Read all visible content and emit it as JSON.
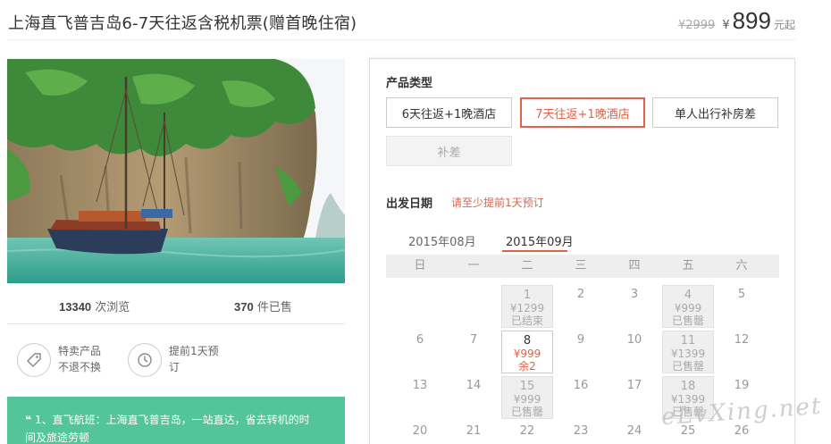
{
  "product": {
    "title": "上海直飞普吉岛6-7天往返含税机票(赠首晚住宿)",
    "original_price": "¥2999",
    "currency_symbol": "¥",
    "price": "899",
    "price_unit": "元起"
  },
  "stats": {
    "views_count": "13340",
    "views_label": "次浏览",
    "sold_count": "370",
    "sold_label": "件已售"
  },
  "features": [
    {
      "icon": "tag-icon",
      "text1": "特卖产品",
      "text2": "不退不换"
    },
    {
      "icon": "clock-icon",
      "text1": "提前1天预",
      "text2": "订"
    }
  ],
  "highlight": {
    "quote": "❝",
    "line1": "1、直飞航班：上海直飞普吉岛，一站直达，省去转机的时",
    "line2": "间及旅途劳顿"
  },
  "product_type": {
    "label": "产品类型",
    "options": [
      "6天往返+1晚酒店",
      "7天往返+1晚酒店",
      "单人出行补房差",
      "补差"
    ]
  },
  "departure": {
    "label": "出发日期",
    "notice": "请至少提前1天预订",
    "months": [
      "2015年08月",
      "2015年09月"
    ],
    "weekdays": [
      "日",
      "一",
      "二",
      "三",
      "四",
      "五",
      "六"
    ],
    "days": [
      {
        "day": "1",
        "price": "¥1299",
        "status": "已结束"
      },
      {
        "day": "2"
      },
      {
        "day": "3"
      },
      {
        "day": "4",
        "price": "¥999",
        "status": "已售罄"
      },
      {
        "day": "5"
      },
      {
        "day": "6"
      },
      {
        "day": "7"
      },
      {
        "day": "8",
        "price": "¥999",
        "status": "余2"
      },
      {
        "day": "9"
      },
      {
        "day": "10"
      },
      {
        "day": "11",
        "price": "¥1399",
        "status": "已售罄"
      },
      {
        "day": "12"
      },
      {
        "day": "13"
      },
      {
        "day": "14"
      },
      {
        "day": "15",
        "price": "¥999",
        "status": "已售罄"
      },
      {
        "day": "16"
      },
      {
        "day": "17"
      },
      {
        "day": "18",
        "price": "¥1399",
        "status": "已售罄"
      },
      {
        "day": "19"
      },
      {
        "day": "20"
      },
      {
        "day": "21"
      },
      {
        "day": "22"
      },
      {
        "day": "23"
      },
      {
        "day": "24"
      },
      {
        "day": "25"
      },
      {
        "day": "26"
      }
    ]
  },
  "watermark": "eLvXing.net",
  "colors": {
    "accent": "#e0624a",
    "highlight_bg": "#54c49a"
  }
}
